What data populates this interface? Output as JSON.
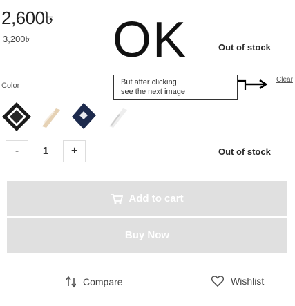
{
  "price": {
    "current": "2,600৳",
    "old": "3,200৳"
  },
  "banner": {
    "big_text": "OK"
  },
  "stock": {
    "top": "Out of stock",
    "middle": "Out of stock"
  },
  "variation": {
    "color_label": "Color",
    "clear_label": "Clear",
    "swatches": [
      "swatch-black-white",
      "swatch-beige",
      "swatch-navy",
      "swatch-light"
    ]
  },
  "note": {
    "line1": "But after clicking",
    "line2": "see the next image"
  },
  "quantity": {
    "minus": "-",
    "value": "1",
    "plus": "+"
  },
  "actions": {
    "add_to_cart": "Add to cart",
    "buy_now": "Buy Now",
    "compare": "Compare",
    "wishlist": "Wishlist"
  },
  "colors": {
    "button_bg": "#e0e0e0",
    "button_text": "#ffffff"
  },
  "icons": [
    "cart-icon",
    "compare-icon",
    "heart-icon",
    "arrow-icon"
  ]
}
